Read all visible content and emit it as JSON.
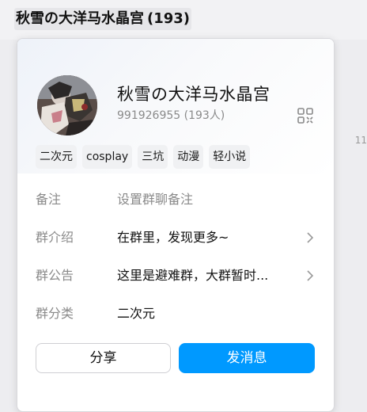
{
  "header": {
    "title": "秋雪の大洋马水晶宫",
    "member_count": "(193)"
  },
  "background_peek_text": "11",
  "card": {
    "group_name": "秋雪の大洋马水晶宫",
    "group_id": "991926955",
    "member_summary": "(193人)",
    "qr_icon": "qr-code-icon",
    "tags": [
      "二次元",
      "cosplay",
      "三坑",
      "动漫",
      "轻小说"
    ],
    "rows": {
      "remark": {
        "label": "备注",
        "value": "设置群聊备注"
      },
      "intro": {
        "label": "群介绍",
        "value": "在群里，发现更多~"
      },
      "notice": {
        "label": "群公告",
        "value": "这里是避难群，大群暂时..."
      },
      "category": {
        "label": "群分类",
        "value": "二次元"
      }
    },
    "buttons": {
      "share": "分享",
      "send_message": "发消息"
    }
  },
  "colors": {
    "accent": "#0099ff",
    "muted_text": "#8a8a8a",
    "tag_bg": "#f0f1f3"
  }
}
